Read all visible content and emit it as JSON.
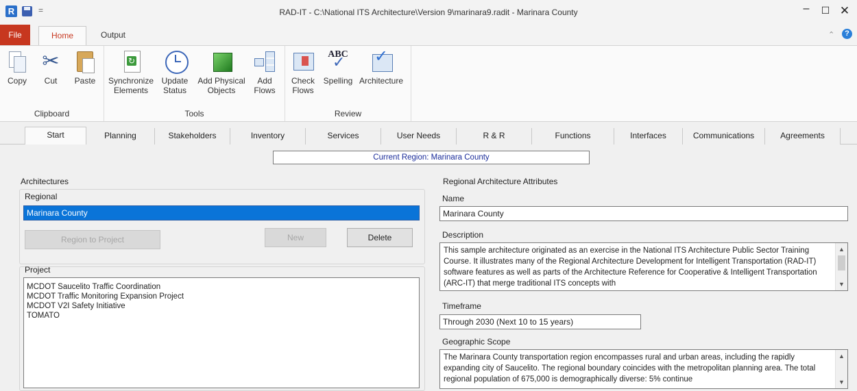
{
  "window": {
    "title": "RAD-IT - C:\\National ITS Architecture\\Version 9\\marinara9.radit - Marinara County",
    "logo": "R",
    "qat_dropdown": "=",
    "minimize": "–",
    "maximize": "☐",
    "close": "✕"
  },
  "ribbon_tabs": {
    "file": "File",
    "home": "Home",
    "output": "Output",
    "collapse": "⌃",
    "help": "?"
  },
  "ribbon": {
    "clipboard": {
      "label": "Clipboard",
      "copy": "Copy",
      "cut": "Cut",
      "paste": "Paste"
    },
    "tools": {
      "label": "Tools",
      "sync_1": "Synchronize",
      "sync_2": "Elements",
      "update_1": "Update",
      "update_2": "Status",
      "addphys_1": "Add Physical",
      "addphys_2": "Objects",
      "addflows_1": "Add",
      "addflows_2": "Flows"
    },
    "review": {
      "label": "Review",
      "check_1": "Check",
      "check_2": "Flows",
      "spelling": "Spelling",
      "architecture": "Architecture",
      "abc": "ABC"
    }
  },
  "tabs": [
    "Start",
    "Planning",
    "Stakeholders",
    "Inventory",
    "Services",
    "User Needs",
    "R & R",
    "Functions",
    "Interfaces",
    "Communications",
    "Agreements"
  ],
  "current_region": "Current Region: Marinara County",
  "architectures": {
    "title": "Architectures",
    "regional_label": "Regional",
    "regional_selected": "Marinara County",
    "region_to_project": "Region to Project",
    "new": "New",
    "delete": "Delete",
    "project_label": "Project",
    "projects": [
      "MCDOT Saucelito Traffic Coordination",
      "MCDOT Traffic Monitoring Expansion Project",
      "MCDOT V2I Safety Initiative",
      "TOMATO"
    ]
  },
  "attributes": {
    "title": "Regional Architecture Attributes",
    "name_label": "Name",
    "name_value": "Marinara County",
    "description_label": "Description",
    "description": "This sample architecture originated as an exercise in the National ITS Architecture Public Sector Training Course.  It illustrates many of the Regional Architecture Development for Intelligent Transportation (RAD-IT) software features as well as parts of the Architecture Reference for Cooperative & Intelligent Transportation (ARC-IT) that merge traditional ITS concepts with",
    "timeframe_label": "Timeframe",
    "timeframe": "Through 2030 (Next 10 to 15 years)",
    "scope_label": "Geographic Scope",
    "scope": "The Marinara County transportation region encompasses rural and urban areas, including the rapidly expanding city of Saucelito. The regional boundary coincides with the metropolitan planning area.  The total regional population of 675,000 is demographically diverse: 5% continue"
  }
}
